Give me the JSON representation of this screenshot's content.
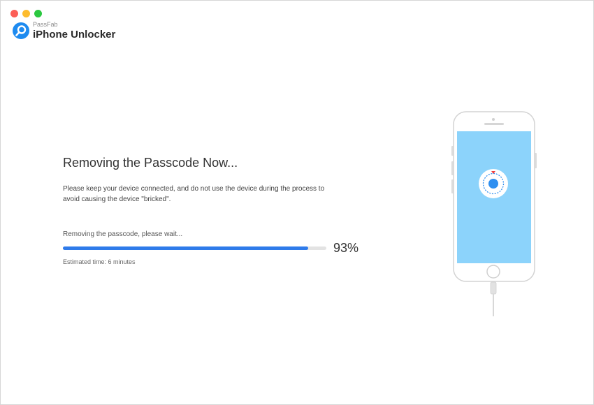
{
  "app": {
    "brand": "PassFab",
    "product": "iPhone Unlocker"
  },
  "main": {
    "heading": "Removing the Passcode Now...",
    "description": "Please keep your device connected, and do not use the device during the process to avoid causing the device \"bricked\".",
    "status_text": "Removing the passcode, please wait...",
    "progress_percent": 93,
    "progress_label": "93%",
    "estimated_time": "Estimated time: 6 minutes"
  },
  "colors": {
    "accent": "#2f7bea",
    "screen": "#8cd3fb",
    "traffic_red": "#fc5f57",
    "traffic_yellow": "#fdbc2e",
    "traffic_green": "#2bc840"
  },
  "illustration": {
    "device": "iphone-illustration",
    "screen_icon": "lock-dial-icon",
    "cable": "lightning-cable-icon"
  }
}
